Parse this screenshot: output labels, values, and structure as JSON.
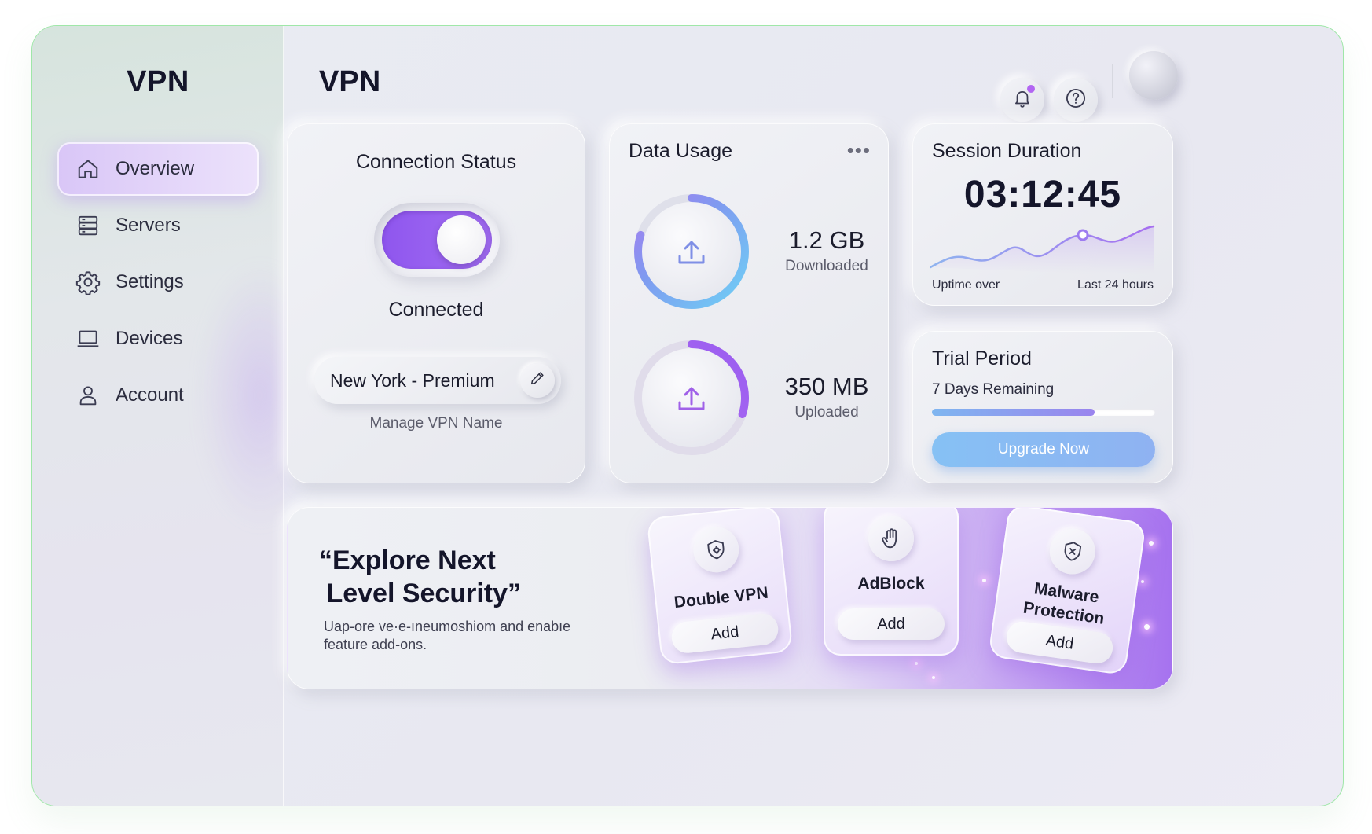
{
  "sidebar": {
    "brand": "VPN",
    "items": [
      {
        "label": "Overview",
        "icon": "home-icon",
        "active": true
      },
      {
        "label": "Servers",
        "icon": "server-icon",
        "active": false
      },
      {
        "label": "Settings",
        "icon": "gear-icon",
        "active": false
      },
      {
        "label": "Devices",
        "icon": "laptop-icon",
        "active": false
      },
      {
        "label": "Account",
        "icon": "user-icon",
        "active": false
      }
    ]
  },
  "header": {
    "title": "VPN",
    "icons": [
      "bell-icon",
      "help-icon",
      "avatar"
    ]
  },
  "connection": {
    "title": "Connection Status",
    "toggle_on": true,
    "state": "Connected",
    "server_name": "New York - Premium",
    "manage_label": "Manage VPN Name"
  },
  "data_usage": {
    "title": "Data Usage",
    "more": "•••",
    "downloaded": {
      "value": "1.2 GB",
      "label": "Downloaded",
      "progress": 0.8
    },
    "uploaded": {
      "value": "350 MB",
      "label": "Uploaded",
      "progress": 0.3
    }
  },
  "session": {
    "title": "Session Duration",
    "time": "03:12:45",
    "caption_left": "Uptime over",
    "caption_right": "Last 24 hours"
  },
  "trial": {
    "title": "Trial Period",
    "remaining": "7 Days Remaining",
    "progress": 0.73,
    "button": "Upgrade Now"
  },
  "explore": {
    "title_line1": "“Explore Next",
    "title_line2": " Level Security”",
    "description": "Uap-ore ve·e-ıneumoshiom and enabıe feature add-ons.",
    "addons": [
      {
        "name": "Double VPN",
        "button": "Add",
        "icon": "shield-settings-icon"
      },
      {
        "name": "AdBlock",
        "button": "Add",
        "icon": "hand-stop-icon"
      },
      {
        "name_line1": "Malware",
        "name_line2": "Protection",
        "button": "Add",
        "icon": "shield-x-icon"
      }
    ]
  },
  "colors": {
    "accent": "#9b5cf0",
    "accent_light": "#d9c6f7",
    "blue": "#7fb6f0",
    "frame_border": "#9fe7a8"
  }
}
